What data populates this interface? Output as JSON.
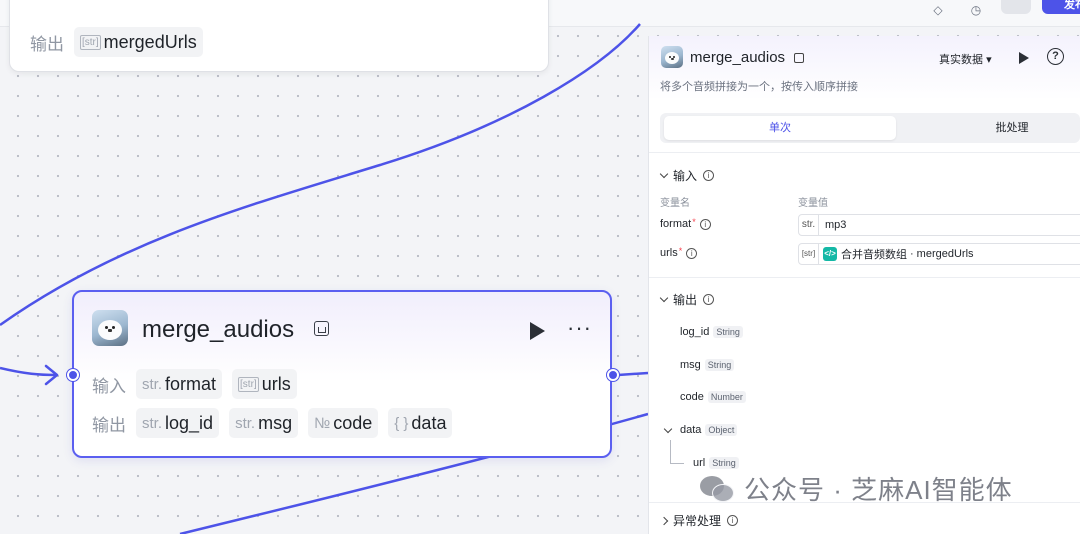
{
  "canvas": {
    "prev_node": {
      "output_label": "输出",
      "output_var": {
        "type": "[str]",
        "name": "mergedUrls"
      }
    },
    "main_node": {
      "title": "merge_audios",
      "more": "···",
      "input_label": "输入",
      "inputs": [
        {
          "type": "str.",
          "name": "format"
        },
        {
          "type": "[str]",
          "name": "urls"
        }
      ],
      "output_label": "输出",
      "outputs": [
        {
          "type": "str.",
          "name": "log_id"
        },
        {
          "type": "str.",
          "name": "msg"
        },
        {
          "type": "№",
          "name": "code"
        },
        {
          "type": "{ }",
          "name": "data"
        }
      ]
    },
    "edge_color": "#4d53e8"
  },
  "top_bar": {
    "publish_label": "发布"
  },
  "panel": {
    "title": "merge_audios",
    "mode_label": "真实数据",
    "help": "?",
    "description": "将多个音频拼接为一个，按传入顺序拼接",
    "tabs": {
      "single": "单次",
      "batch": "批处理"
    },
    "input_section": {
      "title": "输入",
      "col_name": "变量名",
      "col_value": "变量值",
      "rows": [
        {
          "name": "format",
          "type": "str.",
          "value": "mp3"
        },
        {
          "name": "urls",
          "type": "[str]",
          "ref_node": "合并音频数组",
          "ref_var": "mergedUrls"
        }
      ]
    },
    "output_section": {
      "title": "输出",
      "items": [
        {
          "name": "log_id",
          "type": "String"
        },
        {
          "name": "msg",
          "type": "String"
        },
        {
          "name": "code",
          "type": "Number"
        },
        {
          "name": "data",
          "type": "Object"
        },
        {
          "name": "url",
          "type": "String"
        }
      ]
    },
    "error_section": {
      "title": "异常处理"
    }
  },
  "watermark": {
    "text": "公众号 · 芝麻AI智能体"
  },
  "colors": {
    "accent": "#4d53e8",
    "node_border": "#5b5ff0",
    "code_icon": "#14b8a6"
  }
}
